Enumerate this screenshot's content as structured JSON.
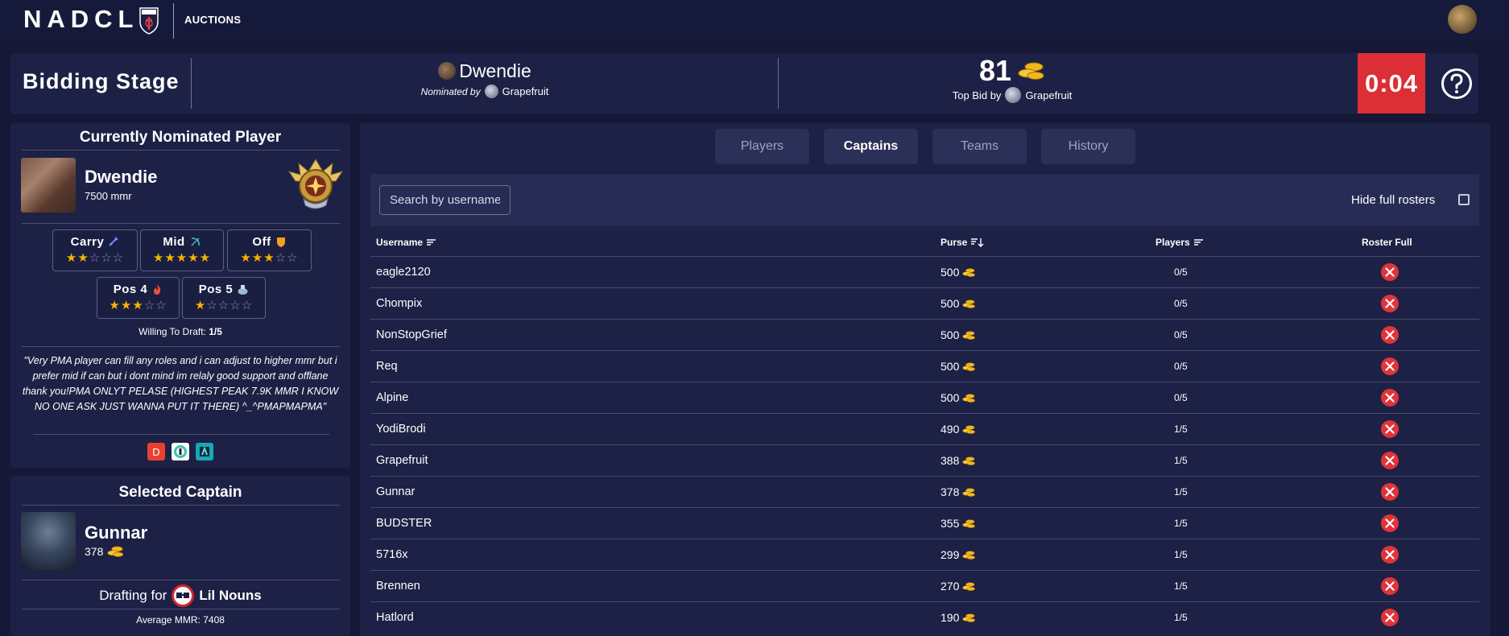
{
  "nav": {
    "brand": "NADCL",
    "badge_text": "NADCL",
    "auctions_link": "AUCTIONS"
  },
  "stage": {
    "title": "Bidding Stage",
    "nominated_player": "Dwendie",
    "nominated_by_label": "Nominated by",
    "nominated_by": "Grapefruit",
    "top_bid": "81",
    "top_bid_by_label": "Top Bid by",
    "top_bid_by": "Grapefruit",
    "timer": "0:04"
  },
  "nominated": {
    "section_title": "Currently Nominated Player",
    "name": "Dwendie",
    "mmr": "7500 mmr",
    "roles": [
      {
        "label": "Carry",
        "icon": "sword-icon",
        "rating": 2
      },
      {
        "label": "Mid",
        "icon": "bow-icon",
        "rating": 5
      },
      {
        "label": "Off",
        "icon": "shield-icon",
        "rating": 3
      },
      {
        "label": "Pos 4",
        "icon": "fire-icon",
        "rating": 3
      },
      {
        "label": "Pos 5",
        "icon": "potion-icon",
        "rating": 1
      }
    ],
    "willing_label": "Willing To Draft:",
    "willing_value": "1/5",
    "quote": "\"Very PMA player can fill any roles and i can adjust to higher mmr but i prefer mid if can but i dont mind im relaly good support and offlane thank you!PMA ONLYT PELASE (HIGHEST PEAK 7.9K MMR I KNOW NO ONE ASK JUST WANNA PUT IT THERE) ^_^PMAPMAPMA\"",
    "services": [
      {
        "icon": "dotabuff-icon",
        "text": "D",
        "color": "#e8412f"
      },
      {
        "icon": "opendota-icon",
        "text": "",
        "color": "#3fc5a6"
      },
      {
        "icon": "stratz-icon",
        "text": "",
        "color": "#1aa7b5"
      }
    ]
  },
  "captain": {
    "section_title": "Selected Captain",
    "name": "Gunnar",
    "purse": "378",
    "drafting_label": "Drafting for",
    "team": "Lil Nouns",
    "avg_mmr": "Average MMR: 7408"
  },
  "tabs": [
    {
      "label": "Players",
      "active": false
    },
    {
      "label": "Captains",
      "active": true
    },
    {
      "label": "Teams",
      "active": false
    },
    {
      "label": "History",
      "active": false
    }
  ],
  "filters": {
    "search_placeholder": "Search by username",
    "hide_full_label": "Hide full rosters",
    "hide_full_checked": false
  },
  "table": {
    "headers": {
      "username": "Username",
      "purse": "Purse",
      "players": "Players",
      "roster_full": "Roster Full"
    },
    "rows": [
      {
        "username": "eagle2120",
        "purse": "500",
        "players": "0/5",
        "full": false
      },
      {
        "username": "Chompix",
        "purse": "500",
        "players": "0/5",
        "full": false
      },
      {
        "username": "NonStopGrief",
        "purse": "500",
        "players": "0/5",
        "full": false
      },
      {
        "username": "Req",
        "purse": "500",
        "players": "0/5",
        "full": false
      },
      {
        "username": "Alpine",
        "purse": "500",
        "players": "0/5",
        "full": false
      },
      {
        "username": "YodiBrodi",
        "purse": "490",
        "players": "1/5",
        "full": false
      },
      {
        "username": "Grapefruit",
        "purse": "388",
        "players": "1/5",
        "full": false
      },
      {
        "username": "Gunnar",
        "purse": "378",
        "players": "1/5",
        "full": false
      },
      {
        "username": "BUDSTER",
        "purse": "355",
        "players": "1/5",
        "full": false
      },
      {
        "username": "5716x",
        "purse": "299",
        "players": "1/5",
        "full": false
      },
      {
        "username": "Brennen",
        "purse": "270",
        "players": "1/5",
        "full": false
      },
      {
        "username": "Hatlord",
        "purse": "190",
        "players": "1/5",
        "full": false
      }
    ]
  },
  "colors": {
    "background": "#151837",
    "panel": "#1d2145",
    "accent_red": "#dc2f35",
    "star": "#f5b400",
    "roster_x": "#e0333a"
  }
}
